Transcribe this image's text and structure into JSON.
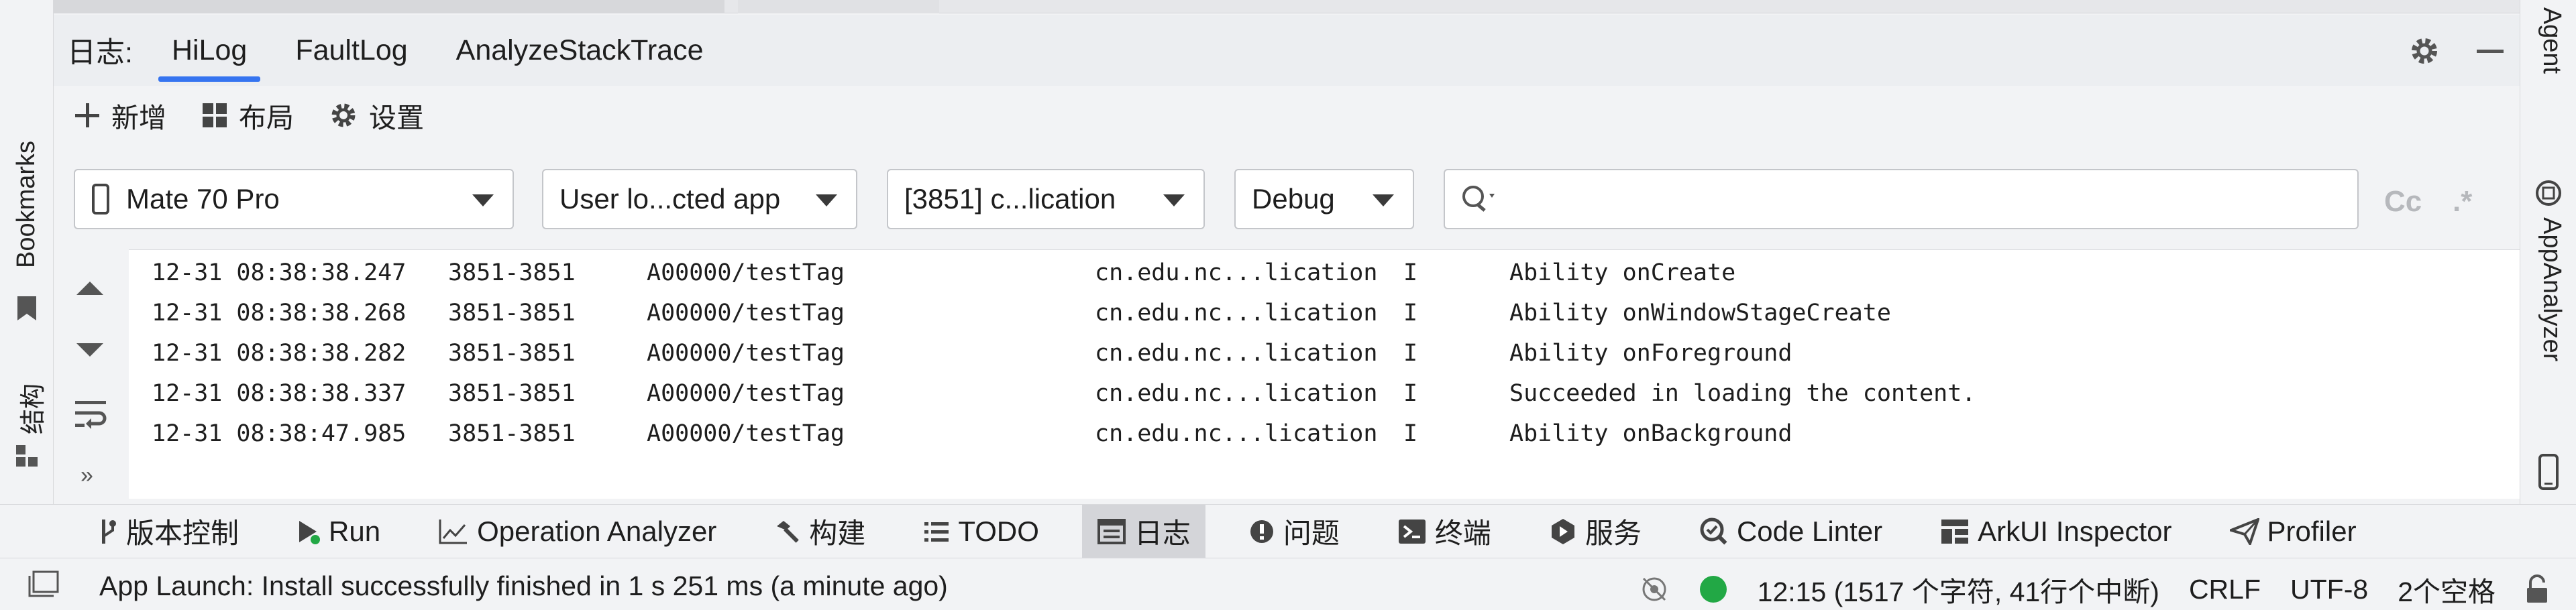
{
  "log_panel": {
    "label": "日志:",
    "tabs": [
      {
        "label": "HiLog",
        "active": true
      },
      {
        "label": "FaultLog",
        "active": false
      },
      {
        "label": "AnalyzeStackTrace",
        "active": false
      }
    ],
    "toolbar": {
      "add": "新增",
      "layout": "布局",
      "settings": "设置"
    }
  },
  "filters": {
    "device": "Mate 70 Pro",
    "scope": "User lo...cted app",
    "process": "[3851] c...lication",
    "level": "Debug",
    "search_placeholder": "",
    "case_option": "Cc",
    "regex_option": ".*"
  },
  "log_entries": [
    {
      "time": "12-31 08:38:38.247",
      "pid": "3851-3851",
      "tag": "A00000/testTag",
      "pkg": "cn.edu.nc...lication",
      "level": "I",
      "message": "Ability onCreate"
    },
    {
      "time": "12-31 08:38:38.268",
      "pid": "3851-3851",
      "tag": "A00000/testTag",
      "pkg": "cn.edu.nc...lication",
      "level": "I",
      "message": "Ability onWindowStageCreate"
    },
    {
      "time": "12-31 08:38:38.282",
      "pid": "3851-3851",
      "tag": "A00000/testTag",
      "pkg": "cn.edu.nc...lication",
      "level": "I",
      "message": "Ability onForeground"
    },
    {
      "time": "12-31 08:38:38.337",
      "pid": "3851-3851",
      "tag": "A00000/testTag",
      "pkg": "cn.edu.nc...lication",
      "level": "I",
      "message": "Succeeded in loading the content."
    },
    {
      "time": "12-31 08:38:47.985",
      "pid": "3851-3851",
      "tag": "A00000/testTag",
      "pkg": "cn.edu.nc...lication",
      "level": "I",
      "message": "Ability onBackground"
    }
  ],
  "side_left": {
    "bookmarks": "Bookmarks",
    "structure": "结构"
  },
  "side_right": {
    "agent": "on Agent",
    "appanalyzer": "AppAnalyzer"
  },
  "tool_windows": [
    {
      "label": "版本控制",
      "icon": "branch-icon",
      "active": false
    },
    {
      "label": "Run",
      "icon": "run-icon",
      "active": false
    },
    {
      "label": "Operation Analyzer",
      "icon": "chart-line-icon",
      "active": false
    },
    {
      "label": "构建",
      "icon": "hammer-icon",
      "active": false
    },
    {
      "label": "TODO",
      "icon": "list-icon",
      "active": false
    },
    {
      "label": "日志",
      "icon": "log-icon",
      "active": true
    },
    {
      "label": "问题",
      "icon": "problem-icon",
      "active": false
    },
    {
      "label": "终端",
      "icon": "terminal-icon",
      "active": false
    },
    {
      "label": "服务",
      "icon": "services-icon",
      "active": false
    },
    {
      "label": "Code Linter",
      "icon": "linter-icon",
      "active": false
    },
    {
      "label": "ArkUI Inspector",
      "icon": "inspector-icon",
      "active": false
    },
    {
      "label": "Profiler",
      "icon": "profiler-icon",
      "active": false
    }
  ],
  "status_bar": {
    "message": "App Launch: Install successfully finished in 1 s 251 ms (a minute ago)",
    "position": "12:15 (1517 个字符, 41行个中断)",
    "line_ending": "CRLF",
    "encoding": "UTF-8",
    "indent": "2个空格",
    "colors": {
      "accent": "#3574f0",
      "ok": "#22a845"
    }
  }
}
